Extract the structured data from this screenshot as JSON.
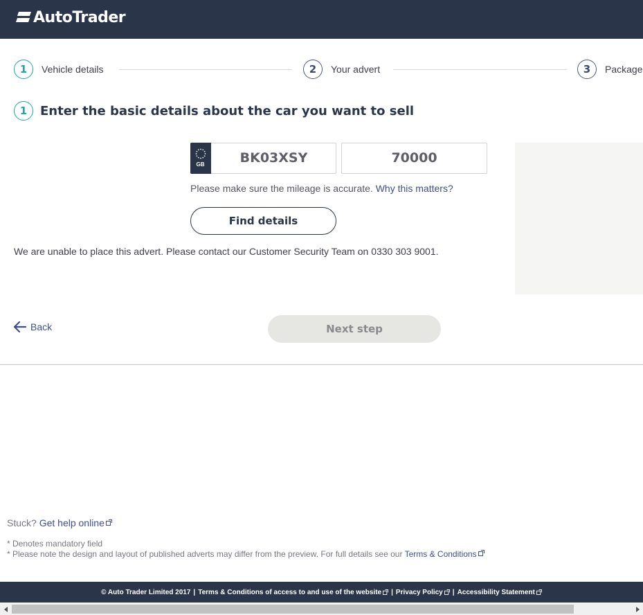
{
  "header": {
    "logo_text": "AutoTrader"
  },
  "steps": [
    {
      "number": "1",
      "label": "Vehicle details",
      "state": "active"
    },
    {
      "number": "2",
      "label": "Your advert",
      "state": "inactive"
    },
    {
      "number": "3",
      "label": "Package",
      "state": "inactive"
    }
  ],
  "section": {
    "number": "1",
    "title": "Enter the basic details about the car you want to sell"
  },
  "registration": {
    "country": "GB",
    "value": "BK03XSY"
  },
  "mileage": {
    "value": "70000"
  },
  "note": {
    "text": "Please make sure the mileage is accurate.",
    "link": "Why this matters?"
  },
  "find_button": "Find details",
  "error_message": "We are unable to place this advert. Please contact our Customer Security Team on 0330 303 9001.",
  "nav": {
    "back_label": "Back",
    "next_label": "Next step"
  },
  "help": {
    "prefix": "Stuck?",
    "link": "Get help online"
  },
  "footnotes": {
    "mandatory": "* Denotes mandatory field",
    "design_note": "* Please note the design and layout of published adverts may differ from the preview. For full details see our",
    "terms_link": "Terms & Conditions"
  },
  "footer": {
    "copyright": "© Auto Trader Limited 2017",
    "terms": "Terms & Conditions of access to and use of the website",
    "privacy": "Privacy Policy",
    "accessibility": "Accessibility Statement",
    "separator": "|"
  },
  "colors": {
    "header_bg": "#2b3549",
    "accent_teal": "#1ea7a4",
    "link": "#3d4f8a",
    "disabled_button": "#e6e6e2"
  },
  "icons": [
    "autotrader-logo-icon",
    "eu-stars-icon",
    "back-arrow-icon",
    "external-link-icon",
    "scroll-left-icon",
    "scroll-right-icon"
  ]
}
